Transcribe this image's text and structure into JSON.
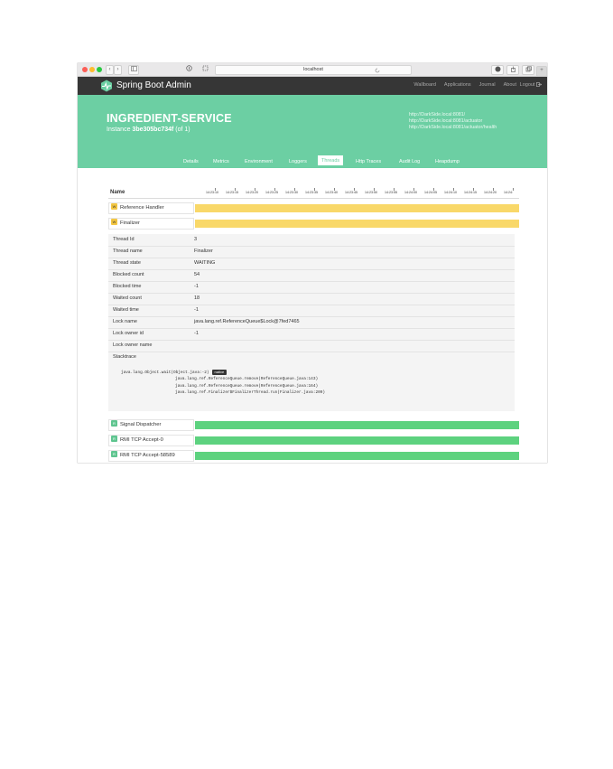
{
  "browser": {
    "url": "localhost",
    "back_glyph": "‹",
    "forward_glyph": "›"
  },
  "navbar": {
    "brand": "Spring Boot Admin",
    "links": [
      "Wallboard",
      "Applications",
      "Journal",
      "About"
    ],
    "logout": "Logout"
  },
  "hero": {
    "app_name": "INGREDIENT-SERVICE",
    "instance_prefix": "Instance",
    "instance_id": "3be305bc734f",
    "instance_suffix": "(of 1)",
    "urls": [
      "http://DarkSide.local:8081/",
      "http://DarkSide.local:8081/actuator",
      "http://DarkSide.local:8081/actuator/health"
    ]
  },
  "tabs": [
    {
      "label": "Details"
    },
    {
      "label": "Metrics"
    },
    {
      "label": "Environment"
    },
    {
      "label": "Loggers"
    },
    {
      "label": "Threads",
      "active": true
    },
    {
      "label": "Http Traces"
    },
    {
      "label": "Audit Log"
    },
    {
      "label": "Heapdump"
    }
  ],
  "threads": {
    "name_header": "Name",
    "time_ticks": [
      "14:23:10",
      "14:23:15",
      "14:23:20",
      "14:23:25",
      "14:23:30",
      "14:23:35",
      "14:23:40",
      "14:23:45",
      "14:23:50",
      "14:23:55",
      "14:24:00",
      "14:24:05",
      "14:24:10",
      "14:24:15",
      "14:24:20",
      "14:24:"
    ],
    "rows": [
      {
        "badge": "W",
        "name": "Reference Handler",
        "state": "waiting"
      },
      {
        "badge": "W",
        "name": "Finalizer",
        "state": "waiting"
      },
      {
        "badge": "R",
        "name": "Signal Dispatcher",
        "state": "runnable"
      },
      {
        "badge": "R",
        "name": "RMI TCP Accept-0",
        "state": "runnable"
      },
      {
        "badge": "R",
        "name": "RMI TCP Accept-58589",
        "state": "runnable"
      }
    ],
    "detail": {
      "rows": [
        {
          "key": "Thread Id",
          "value": "3"
        },
        {
          "key": "Thread name",
          "value": "Finalizer"
        },
        {
          "key": "Thread state",
          "value": "WAITING"
        },
        {
          "key": "Blocked count",
          "value": "54"
        },
        {
          "key": "Blocked time",
          "value": "-1"
        },
        {
          "key": "Waited count",
          "value": "18"
        },
        {
          "key": "Waited time",
          "value": "-1"
        },
        {
          "key": "Lock name",
          "value": "java.lang.ref.ReferenceQueue$Lock@7fed7465"
        },
        {
          "key": "Lock owner id",
          "value": "-1"
        },
        {
          "key": "Lock owner name",
          "value": ""
        },
        {
          "key": "Stacktrace",
          "value": ""
        }
      ],
      "stacktrace": [
        "java.lang.Object.wait(Object.java:-2)",
        "java.lang.ref.ReferenceQueue.remove(ReferenceQueue.java:143)",
        "java.lang.ref.ReferenceQueue.remove(ReferenceQueue.java:164)",
        "java.lang.ref.Finalizer$FinalizerThread.run(Finalizer.java:209)"
      ],
      "native_label": "native"
    }
  },
  "colors": {
    "navbar": "#363636",
    "hero": "#6ccfa3",
    "waiting": "#f9d869",
    "runnable": "#5dd27f"
  }
}
